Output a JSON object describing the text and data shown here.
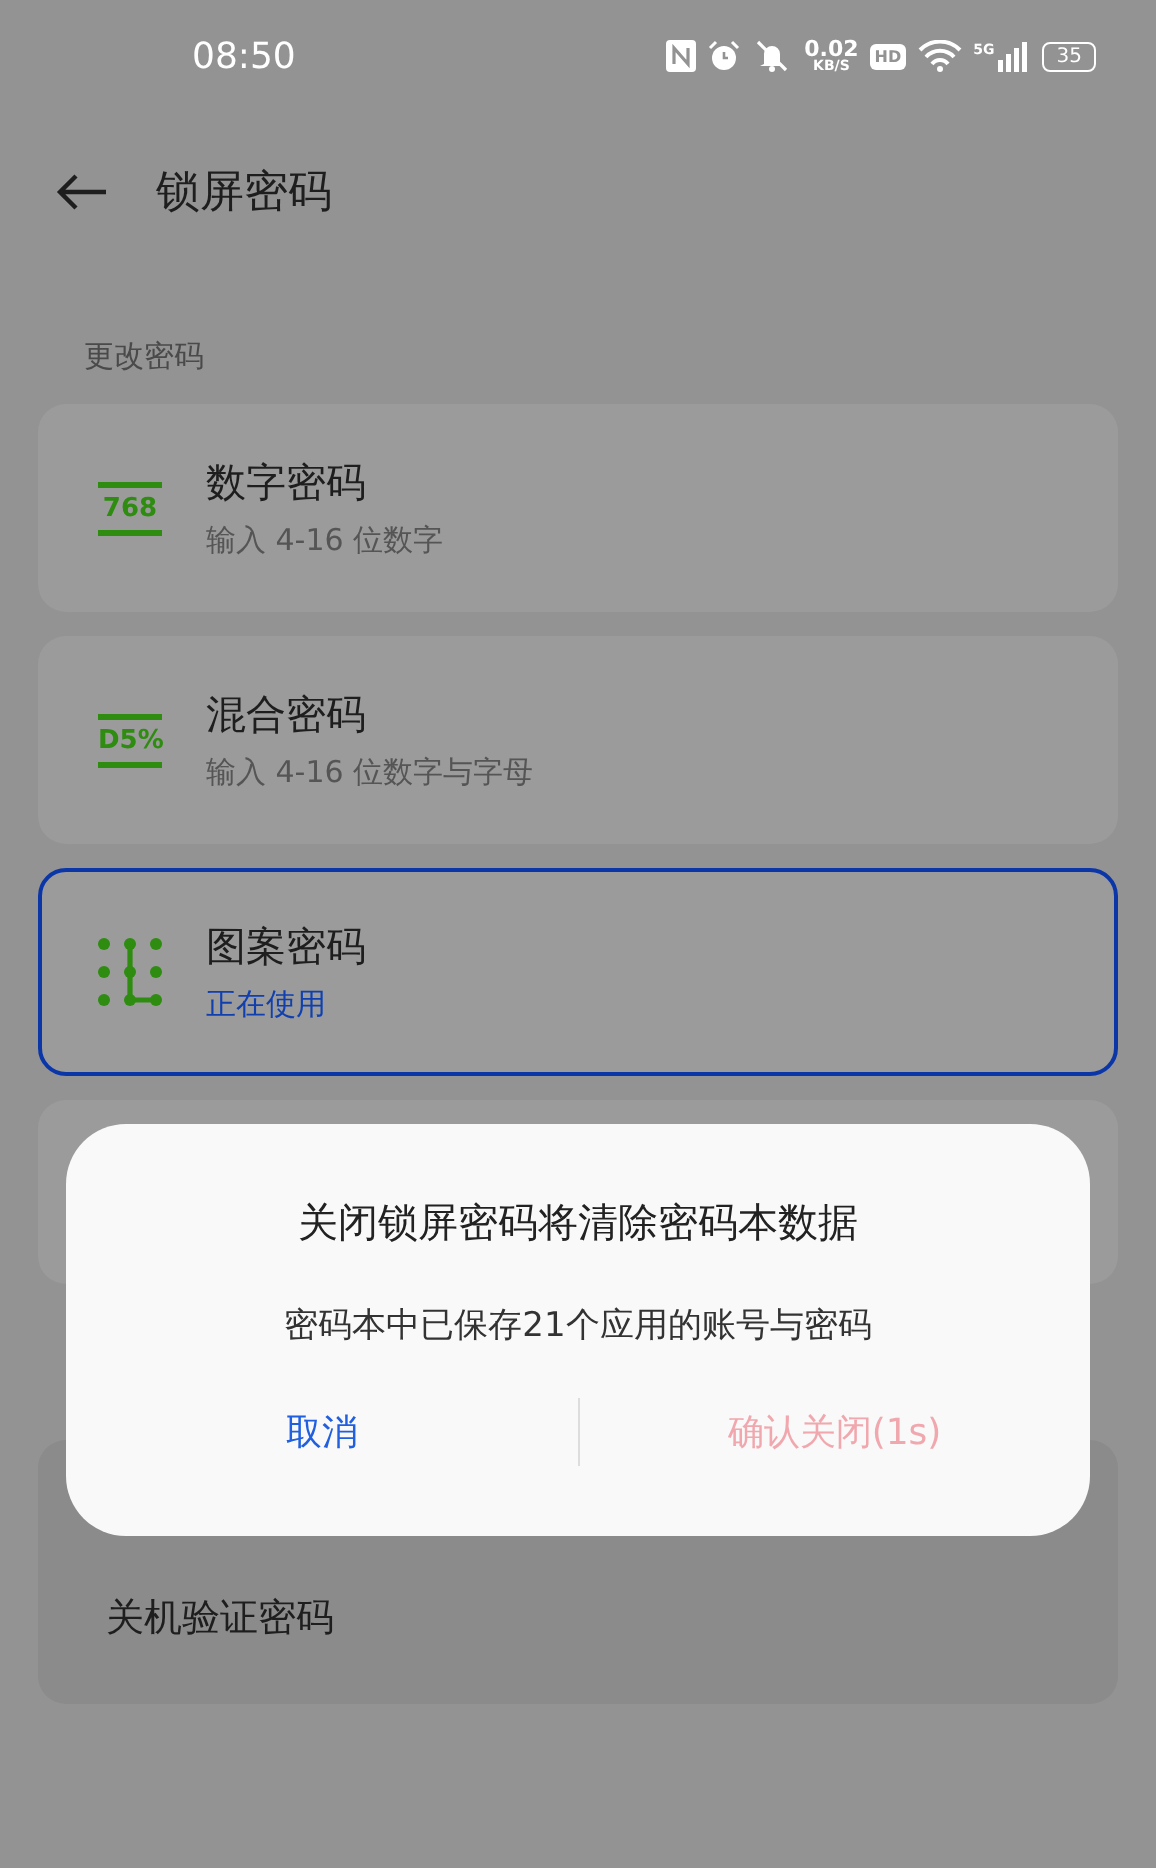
{
  "status_bar": {
    "time": "08:50",
    "net_speed": "0.02",
    "net_unit": "KB/S",
    "hd": "HD",
    "network": "5G",
    "battery": "35"
  },
  "header": {
    "title": "锁屏密码"
  },
  "section_title": "更改密码",
  "options": [
    {
      "kind": "digits",
      "icon_text": "768",
      "title": "数字密码",
      "subtitle": "输入 4-16 位数字",
      "selected": false
    },
    {
      "kind": "mixed",
      "icon_text": "D5%",
      "title": "混合密码",
      "subtitle": "输入 4-16 位数字与字母",
      "selected": false
    },
    {
      "kind": "pattern",
      "title": "图案密码",
      "subtitle": "正在使用",
      "selected": true
    }
  ],
  "suggestions": {
    "items": [
      "关机验证密码"
    ]
  },
  "dialog": {
    "title": "关闭锁屏密码将清除密码本数据",
    "message": "密码本中已保存21个应用的账号与密码",
    "cancel": "取消",
    "confirm": "确认关闭(1s)",
    "confirm_disabled": true
  }
}
